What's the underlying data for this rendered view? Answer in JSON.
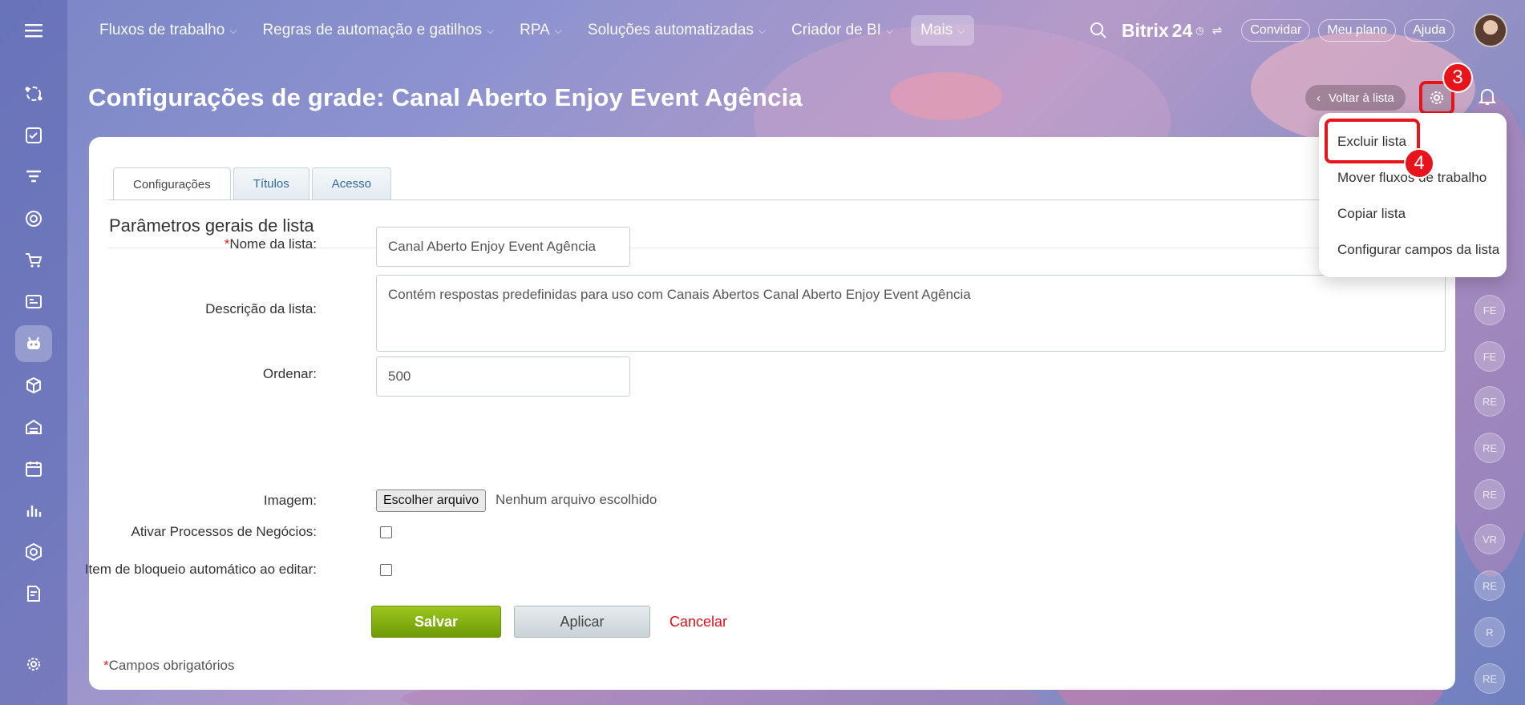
{
  "topnav": {
    "items": [
      {
        "label": "Fluxos de trabalho"
      },
      {
        "label": "Regras de automação e gatilhos"
      },
      {
        "label": "RPA"
      },
      {
        "label": "Soluções automatizadas"
      },
      {
        "label": "Criador de BI"
      },
      {
        "label": "Mais"
      }
    ],
    "brand": "Bitrix",
    "brand_num": "24",
    "invite": "Convidar",
    "plan": "Meu plano",
    "help": "Ajuda"
  },
  "page": {
    "title": "Configurações de grade: Canal Aberto Enjoy Event Agência",
    "back_label": "Voltar à lista"
  },
  "annotations": {
    "gear_badge": "3",
    "menu_badge": "4"
  },
  "menu": {
    "items": [
      "Excluir lista",
      "Mover fluxos de trabalho",
      "Copiar lista",
      "Configurar campos da lista"
    ]
  },
  "tabs": [
    "Configurações",
    "Títulos",
    "Acesso"
  ],
  "section_title": "Parâmetros gerais de lista",
  "form": {
    "name_label": "Nome da lista:",
    "name_required_mark": "*",
    "name_value": "Canal Aberto Enjoy Event Agência",
    "desc_label": "Descrição da lista:",
    "desc_value": "Contém respostas predefinidas para uso com Canais Abertos Canal Aberto Enjoy Event Agência",
    "sort_label": "Ordenar:",
    "sort_value": "500",
    "image_label": "Imagem:",
    "file_button": "Escolher arquivo",
    "file_none": "Nenhum arquivo escolhido",
    "bp_label": "Ativar Processos de Negócios:",
    "lock_label": "Item de bloqueio automático ao editar:"
  },
  "buttons": {
    "save": "Salvar",
    "apply": "Aplicar",
    "cancel": "Cancelar"
  },
  "required_note_mark": "*",
  "required_note": "Campos obrigatórios",
  "members": [
    "FE",
    "FE",
    "RE",
    "RE",
    "RE",
    "VR",
    "RE",
    "R",
    "RE"
  ],
  "colors": {
    "accent_red": "#e8141c",
    "save_green": "#7fab0e",
    "link_blue": "#2f6aa0"
  }
}
